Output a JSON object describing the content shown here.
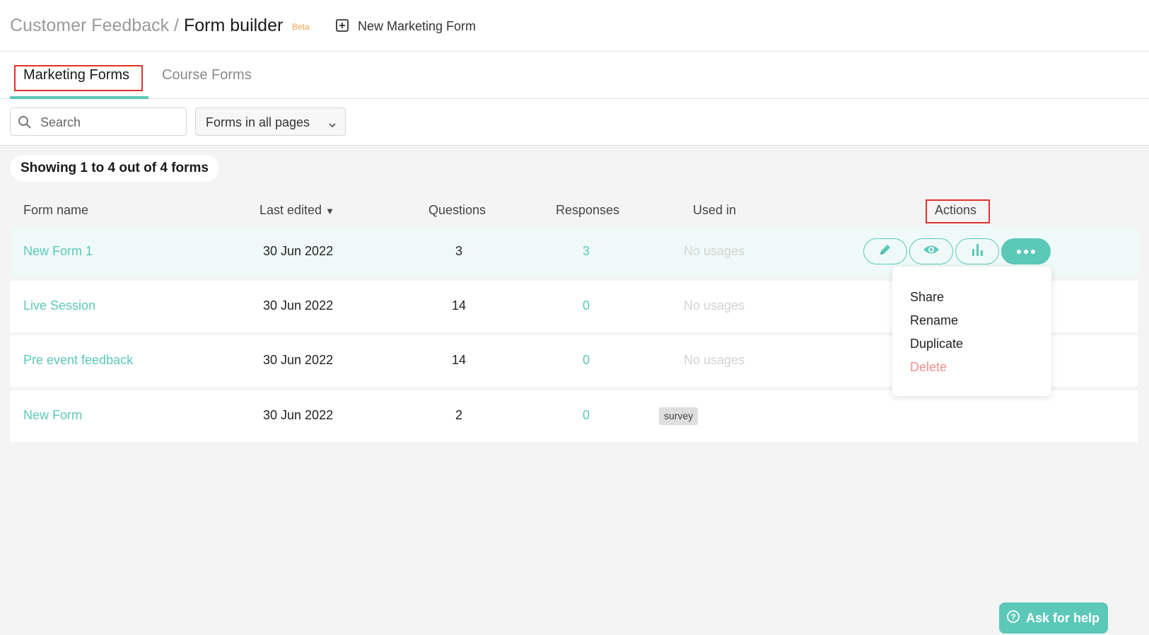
{
  "header": {
    "breadcrumb_parent": "Customer Feedback /",
    "title": "Form builder",
    "badge": "Beta",
    "new_form_label": "New Marketing Form"
  },
  "tabs": [
    {
      "label": "Marketing Forms",
      "active": true
    },
    {
      "label": "Course Forms",
      "active": false
    }
  ],
  "filters": {
    "search_placeholder": "Search",
    "scope_selected": "Forms in all pages"
  },
  "summary": "Showing 1 to 4 out of 4 forms",
  "table": {
    "headers": {
      "name": "Form name",
      "edited": "Last edited",
      "sort_indicator": "▼",
      "questions": "Questions",
      "responses": "Responses",
      "used_in": "Used in",
      "actions": "Actions"
    },
    "rows": [
      {
        "name": "New Form 1",
        "edited": "30 Jun 2022",
        "questions": "3",
        "responses": "3",
        "used_in": "No usages"
      },
      {
        "name": "Live Session",
        "edited": "30 Jun 2022",
        "questions": "14",
        "responses": "0",
        "used_in": "No usages"
      },
      {
        "name": "Pre event feedback",
        "edited": "30 Jun 2022",
        "questions": "14",
        "responses": "0",
        "used_in": "No usages"
      },
      {
        "name": "New Form",
        "edited": "30 Jun 2022",
        "questions": "2",
        "responses": "0",
        "used_in_tag": "survey"
      }
    ]
  },
  "row_actions": {
    "icons": [
      "pencil-icon",
      "eye-icon",
      "bar-chart-icon",
      "more-icon"
    ]
  },
  "dropdown_menu": {
    "items": [
      "Share",
      "Rename",
      "Duplicate",
      "Delete"
    ]
  },
  "help": {
    "label": "Ask for help"
  },
  "colors": {
    "accent": "#5cc8b8",
    "highlight_row": "#effaf8",
    "annotation_box": "#e0322d",
    "beta_badge": "#f0a04b",
    "delete": "#ef8f8a"
  }
}
